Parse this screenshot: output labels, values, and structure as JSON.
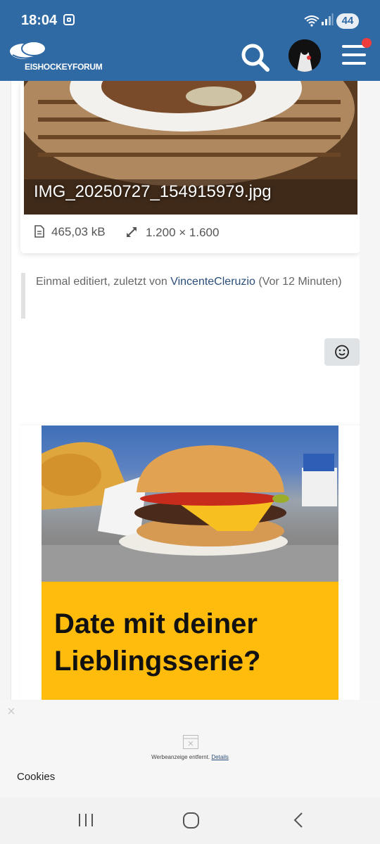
{
  "status_bar": {
    "time": "18:04",
    "battery": "44",
    "wifi_badge": "5"
  },
  "header": {
    "site_name": "EISHOCKEYFORUM",
    "accent_color": "#2f6aa5",
    "notification_dot_color": "#ef3c3c"
  },
  "attachment": {
    "filename": "IMG_20250727_154915979.jpg",
    "filesize": "465,03 kB",
    "dimensions": "1.200 × 1.600"
  },
  "edit_note": {
    "prefix": "Einmal editiert, zuletzt von ",
    "user": "VincenteCleruzio",
    "suffix": " (Vor 12 Minuten)"
  },
  "reaction_icon": "smiley-icon",
  "ad": {
    "headline_line1": "Date mit deiner",
    "headline_line2": "Lieblingsserie?",
    "brand_color": "#ffbc0d"
  },
  "cookie_bar": {
    "removed_text": "Werbeanzeige entfernt.",
    "details_link": "Details",
    "cookies_label": "Cookies"
  }
}
